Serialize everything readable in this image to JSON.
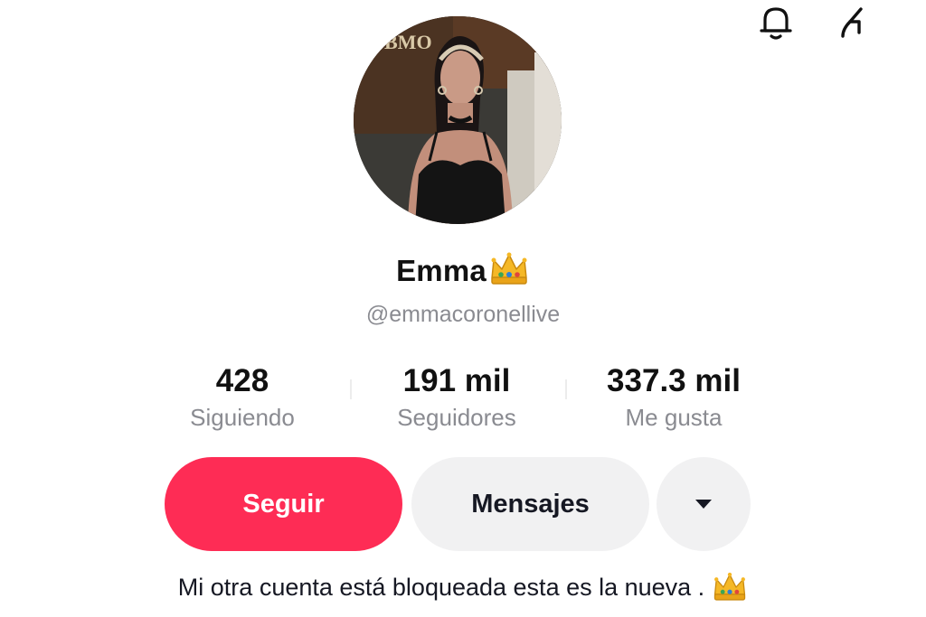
{
  "profile": {
    "display_name": "Emma",
    "username": "@emmacoronellive",
    "bio": "Mi otra cuenta está bloqueada esta es la nueva ."
  },
  "stats": [
    {
      "value": "428",
      "label": "Siguiendo"
    },
    {
      "value": "191 mil",
      "label": "Seguidores"
    },
    {
      "value": "337.3 mil",
      "label": "Me gusta"
    }
  ],
  "actions": {
    "follow_label": "Seguir",
    "message_label": "Mensajes",
    "more_icon": "caret-down-icon"
  },
  "header_icons": [
    "bell-icon",
    "share-icon"
  ],
  "colors": {
    "accent": "#fe2c55",
    "secondary_bg": "#f1f1f2",
    "muted_text": "#8a8b91"
  }
}
